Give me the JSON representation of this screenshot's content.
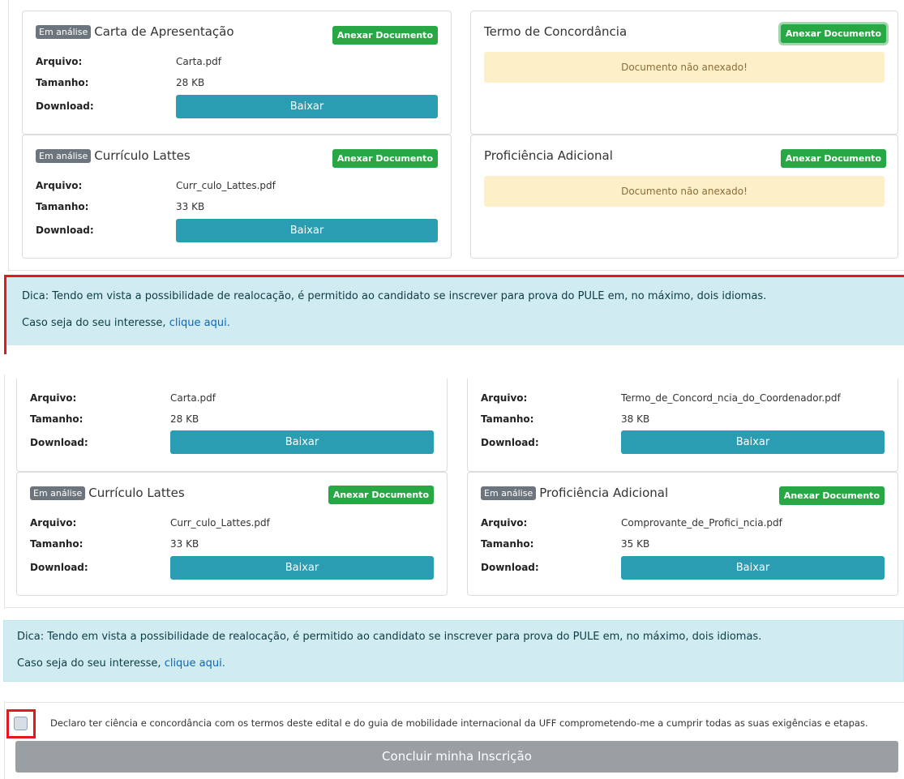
{
  "panel1": {
    "carta": {
      "badge": "Em análise",
      "title": "Carta de Apresentação",
      "attach": "Anexar Documento",
      "label_file": "Arquivo:",
      "label_size": "Tamanho:",
      "label_download": "Download:",
      "file": "Carta.pdf",
      "size": "28 KB",
      "download": "Baixar"
    },
    "termo": {
      "title": "Termo de Concordância",
      "attach": "Anexar Documento",
      "warning": "Documento não anexado!"
    },
    "curriculo": {
      "badge": "Em análise",
      "title": "Currículo Lattes",
      "attach": "Anexar Documento",
      "label_file": "Arquivo:",
      "label_size": "Tamanho:",
      "label_download": "Download:",
      "file": "Curr_culo_Lattes.pdf",
      "size": "33 KB",
      "download": "Baixar"
    },
    "proficiencia": {
      "title": "Proficiência Adicional",
      "attach": "Anexar Documento",
      "warning": "Documento não anexado!"
    }
  },
  "tip": {
    "text": "Dica: Tendo em vista a possibilidade de realocação, é permitido ao candidato se inscrever para prova do PULE em, no máximo, dois idiomas.",
    "prefix": "Caso seja do seu interesse, ",
    "link": "clique aqui."
  },
  "panel2": {
    "carta": {
      "label_file": "Arquivo:",
      "label_size": "Tamanho:",
      "label_download": "Download:",
      "file": "Carta.pdf",
      "size": "28 KB",
      "download": "Baixar"
    },
    "termo": {
      "label_file": "Arquivo:",
      "label_size": "Tamanho:",
      "label_download": "Download:",
      "file": "Termo_de_Concord_ncia_do_Coordenador.pdf",
      "size": "38 KB",
      "download": "Baixar"
    },
    "curriculo": {
      "badge": "Em análise",
      "title": "Currículo Lattes",
      "attach": "Anexar Documento",
      "label_file": "Arquivo:",
      "label_size": "Tamanho:",
      "label_download": "Download:",
      "file": "Curr_culo_Lattes.pdf",
      "size": "33 KB",
      "download": "Baixar"
    },
    "proficiencia": {
      "badge": "Em análise",
      "title": "Proficiência Adicional",
      "attach": "Anexar Documento",
      "label_file": "Arquivo:",
      "label_size": "Tamanho:",
      "label_download": "Download:",
      "file": "Comprovante_de_Profici_ncia.pdf",
      "size": "35 KB",
      "download": "Baixar"
    }
  },
  "declaration": {
    "checked": false,
    "text": "Declaro ter ciência e concordância com os termos deste edital e do guia de mobilidade internacional da UFF comprometendo-me a cumprir todas as suas exigências e etapas.",
    "submit": "Concluir minha Inscrição"
  },
  "colors": {
    "green": "#28a745",
    "teal": "#2a9db3",
    "warning_bg": "#fdefc8",
    "tip_bg": "#d1ecf1",
    "highlight_red": "#e0191f",
    "submit_gray": "#9a9fa4"
  }
}
